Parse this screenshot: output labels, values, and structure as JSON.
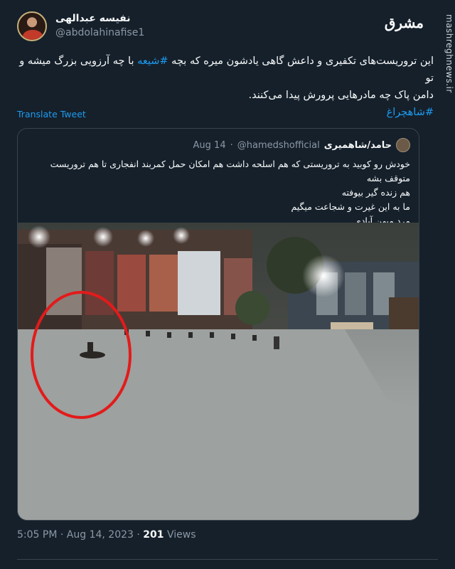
{
  "author": {
    "display_name": "نفیسه عبدالهی",
    "handle": "@abdolahinafise1"
  },
  "site": {
    "logo_text": "مشرق",
    "watermark": "mashreghnews.ir"
  },
  "tweet": {
    "text_line1": "این تروریست‌های تکفیری و داعش گاهی یادشون میره که بچه ",
    "hashtag1": "#شیعه",
    "text_line1_after": " با چه آرزویی بزرگ میشه و تو",
    "text_line2": "دامن پاک چه مادرهایی پرورش پیدا می‌کنند.",
    "hashtag2": "#شاهچراغ",
    "translate_label": "Translate Tweet"
  },
  "quoted": {
    "display_name": "حامد/شاهمیری",
    "handle": "@hamedshofficial",
    "separator": "·",
    "date": "Aug 14",
    "lines": [
      "خودش رو کوبید به تروریستی که هم اسلحه داشت هم امکان حمل کمربند انفجاری تا هم تروریست متوقف بشه",
      "هم زنده گیر بیوفته",
      "ما به این غیرت و شجاعت میگیم",
      "مرد میهن آبادی"
    ]
  },
  "footer": {
    "time": "5:05 PM",
    "sep1": "·",
    "date": "Aug 14, 2023",
    "sep2": "·",
    "views_count": "201",
    "views_label": "Views"
  },
  "colors": {
    "background": "#15202b",
    "link": "#1d9bf0",
    "muted": "#8b98a5",
    "border": "#38444d",
    "highlight_circle": "#e21b1b"
  }
}
